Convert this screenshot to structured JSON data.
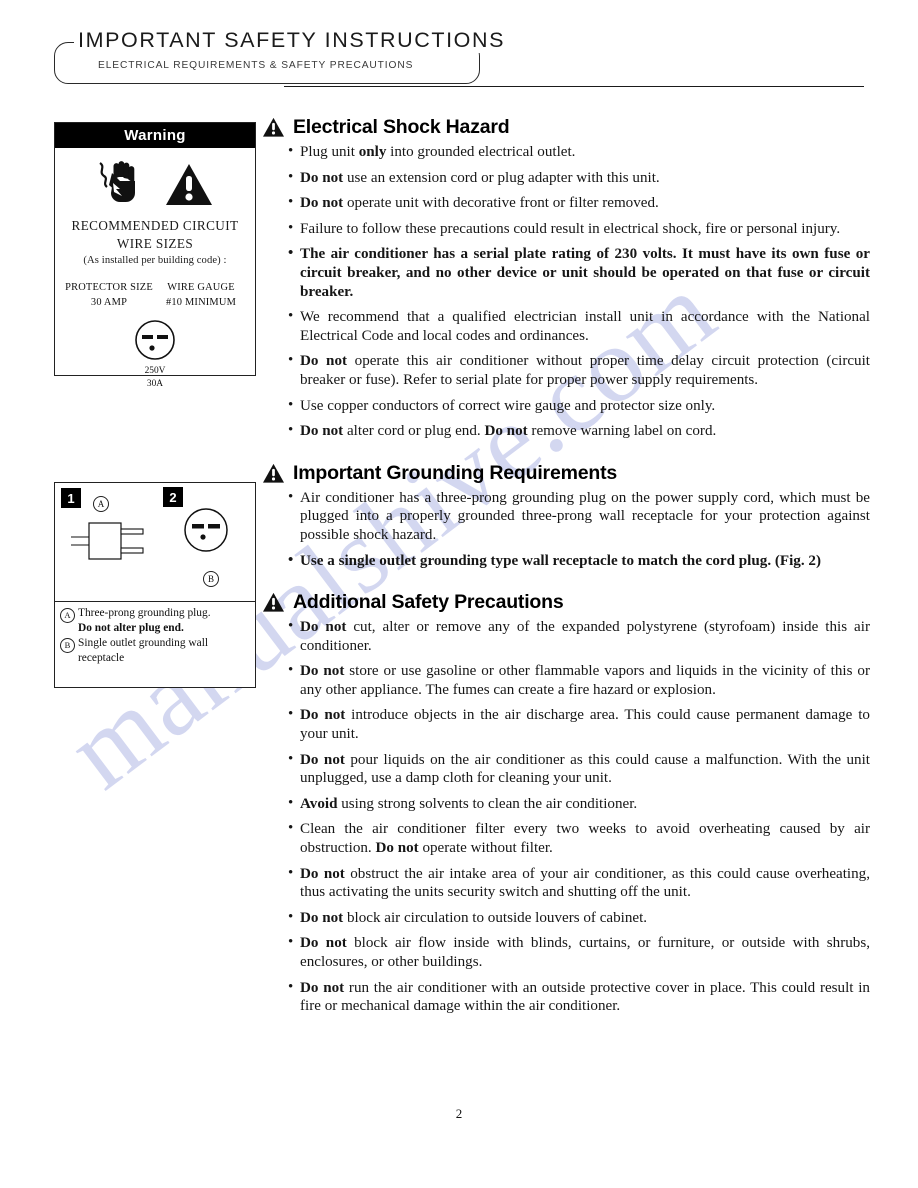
{
  "header": {
    "title": "IMPORTANT SAFETY INSTRUCTIONS",
    "subtitle": "ELECTRICAL REQUIREMENTS & SAFETY PRECAUTIONS"
  },
  "watermark": {
    "text": "manualshive.com",
    "color": "#b9bfe8"
  },
  "warning_box": {
    "title": "Warning",
    "icons": [
      "electric-shock-hand-icon",
      "warning-triangle-icon"
    ],
    "line1": "RECOMMENDED CIRCUIT",
    "line2": "WIRE SIZES",
    "line3": "(As installed per building code) :",
    "col1_head": "PROTECTOR SIZE",
    "col1_value": "30 AMP",
    "col2_head": "WIRE GAUGE",
    "col2_value": "#10 MINIMUM",
    "outlet_caption_1": "250V",
    "outlet_caption_2": "30A"
  },
  "figure_box": {
    "fig1_number": "1",
    "fig2_number": "2",
    "callout_a": "A",
    "callout_b": "B",
    "caption_a_mark": "A",
    "caption_a_text": "Three-prong grounding plug.",
    "caption_a_bold": "Do not alter plug end.",
    "caption_b_mark": "B",
    "caption_b_text": "Single outlet grounding wall receptacle"
  },
  "sections": [
    {
      "heading": "Electrical Shock Hazard",
      "bullets": [
        {
          "html": "Plug unit <b>only</b> into grounded electrical outlet.",
          "bold_all": false
        },
        {
          "html": "<b>Do not</b> use an extension cord or plug adapter with this unit.",
          "bold_all": false
        },
        {
          "html": "<b>Do not</b> operate unit with decorative front or filter removed.",
          "bold_all": false
        },
        {
          "html": "Failure to follow these precautions could result in electrical shock, fire or personal injury.",
          "bold_all": false
        },
        {
          "html": "The air conditioner has a serial plate rating of 230 volts. It must have its own fuse or circuit breaker, and no other device or unit should be operated on that fuse or circuit breaker.",
          "bold_all": true
        },
        {
          "html": "We recommend that a qualified electrician install unit in accordance with the National Electrical Code and local codes and ordinances.",
          "bold_all": false
        },
        {
          "html": "<b>Do not</b> operate this air conditioner without proper time delay circuit protection (circuit breaker or fuse). Refer to serial plate for proper power supply requirements.",
          "bold_all": false
        },
        {
          "html": "Use copper conductors of correct wire gauge and protector size only.",
          "bold_all": false
        },
        {
          "html": "<b>Do not</b> alter cord or plug end. <b>Do not</b> remove warning label on cord.",
          "bold_all": false
        }
      ]
    },
    {
      "heading": "Important Grounding Requirements",
      "bullets": [
        {
          "html": "Air conditioner has a three-prong grounding plug on the power supply cord, which must be plugged into a properly grounded three-prong wall receptacle for your protection against possible shock hazard.",
          "bold_all": false
        },
        {
          "html": "Use a single outlet grounding type wall receptacle to match the cord plug. (Fig. 2)",
          "bold_all": true
        }
      ]
    },
    {
      "heading": "Additional Safety Precautions",
      "bullets": [
        {
          "html": "<b>Do not</b> cut, alter or remove any of the expanded polystyrene (styrofoam) inside this air conditioner.",
          "bold_all": false
        },
        {
          "html": "<b>Do not</b> store or use gasoline or other flammable vapors and liquids in the vicinity of this or any other appliance. The fumes can create a fire hazard or explosion.",
          "bold_all": false
        },
        {
          "html": "<b>Do not</b> introduce objects in the air discharge area. This could cause permanent damage to your unit.",
          "bold_all": false
        },
        {
          "html": "<b>Do not</b> pour liquids on the air conditioner as this could cause a malfunction. With the unit unplugged, use a damp cloth for cleaning your unit.",
          "bold_all": false
        },
        {
          "html": "<b>Avoid</b> using strong solvents to clean the air conditioner.",
          "bold_all": false
        },
        {
          "html": "Clean the air conditioner filter every two weeks to avoid overheating caused by air obstruction. <b>Do not</b> operate without filter.",
          "bold_all": false
        },
        {
          "html": "<b>Do not</b> obstruct the air intake area of your air conditioner, as this could cause overheating, thus activating the units security switch and shutting off the unit.",
          "bold_all": false
        },
        {
          "html": "<b>Do not</b> block air circulation to outside louvers of cabinet.",
          "bold_all": false
        },
        {
          "html": "<b>Do not</b> block air flow inside with blinds, curtains, or furniture, or outside with shrubs, enclosures, or other buildings.",
          "bold_all": false
        },
        {
          "html": "<b>Do not</b> run the air conditioner with an outside protective cover in place. This could result in fire or mechanical damage within the air conditioner.",
          "bold_all": false
        }
      ]
    }
  ],
  "footer": {
    "page_number": "2"
  }
}
